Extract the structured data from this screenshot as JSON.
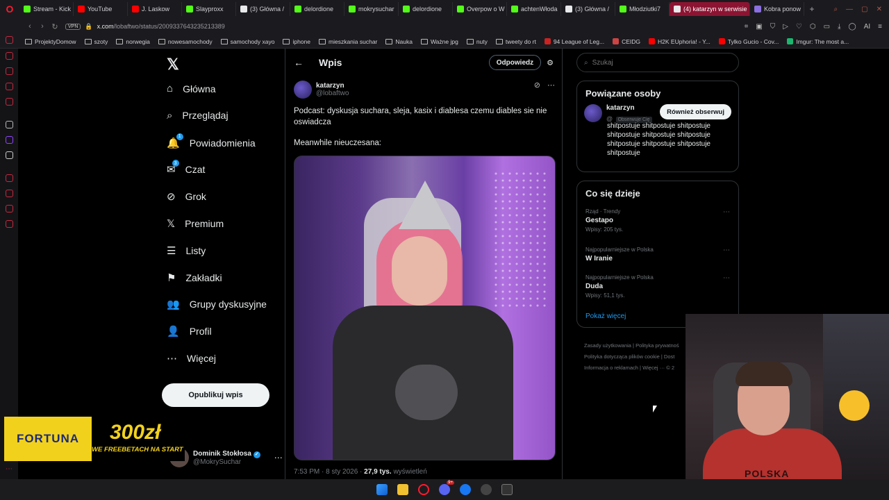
{
  "browser": {
    "tabs": [
      {
        "label": "Stream - Kick",
        "color": "#53fc18",
        "active": false
      },
      {
        "label": "YouTube",
        "color": "#ff0000",
        "active": false
      },
      {
        "label": "J. Laskow",
        "color": "#ff0000",
        "active": false
      },
      {
        "label": "Slayproxx",
        "color": "#53fc18",
        "active": false
      },
      {
        "label": "(3) Główna /",
        "color": "#e7e9ea",
        "active": false
      },
      {
        "label": "delordione",
        "color": "#53fc18",
        "active": false
      },
      {
        "label": "mokrysuchar",
        "color": "#53fc18",
        "active": false
      },
      {
        "label": "delordione",
        "color": "#53fc18",
        "active": false
      },
      {
        "label": "Overpow o W",
        "color": "#53fc18",
        "active": false
      },
      {
        "label": "achtenWłoda",
        "color": "#53fc18",
        "active": false
      },
      {
        "label": "(3) Główna /",
        "color": "#e7e9ea",
        "active": false
      },
      {
        "label": "Młodziutki7",
        "color": "#53fc18",
        "active": false
      },
      {
        "label": "(4) katarzyn w serwisie",
        "color": "#e7e9ea",
        "active": true
      },
      {
        "label": "Kobra ponow",
        "color": "#8a6fe0",
        "active": false
      }
    ],
    "vpn_label": "VPN",
    "url_host": "x.com",
    "url_path": "/lobaftwo/status/2009337643235213389",
    "ai_label": "AI",
    "bookmarks": [
      {
        "label": "ProjektyDomow",
        "type": "folder"
      },
      {
        "label": "szoty",
        "type": "folder"
      },
      {
        "label": "norwegia",
        "type": "folder"
      },
      {
        "label": "nowesamochody",
        "type": "folder"
      },
      {
        "label": "samochody xayo",
        "type": "folder"
      },
      {
        "label": "iphone",
        "type": "folder"
      },
      {
        "label": "mieszkania suchar",
        "type": "folder"
      },
      {
        "label": "Nauka",
        "type": "folder"
      },
      {
        "label": "Ważne jpg",
        "type": "folder"
      },
      {
        "label": "nuty",
        "type": "folder"
      },
      {
        "label": "tweety do rt",
        "type": "folder"
      },
      {
        "label": "94 League of Leg...",
        "type": "site",
        "color": "#c22"
      },
      {
        "label": "CEIDG",
        "type": "site",
        "color": "#c44"
      },
      {
        "label": "H2K EUphoria! - Y...",
        "type": "site",
        "color": "#ff0000"
      },
      {
        "label": "Tylko Gucio - Cov...",
        "type": "site",
        "color": "#ff0000"
      },
      {
        "label": "Imgur: The most a...",
        "type": "site",
        "color": "#1bb76e"
      }
    ]
  },
  "nav": {
    "items": [
      {
        "label": "Główna",
        "icon": "⌂",
        "badge": ""
      },
      {
        "label": "Przeglądaj",
        "icon": "⌕",
        "badge": ""
      },
      {
        "label": "Powiadomienia",
        "icon": "🔔",
        "badge": "1"
      },
      {
        "label": "Czat",
        "icon": "✉",
        "badge": "3"
      },
      {
        "label": "Grok",
        "icon": "⊘",
        "badge": ""
      },
      {
        "label": "Premium",
        "icon": "𝕏",
        "badge": ""
      },
      {
        "label": "Listy",
        "icon": "☰",
        "badge": ""
      },
      {
        "label": "Zakładki",
        "icon": "⚑",
        "badge": ""
      },
      {
        "label": "Grupy dyskusyjne",
        "icon": "👥",
        "badge": ""
      },
      {
        "label": "Profil",
        "icon": "👤",
        "badge": ""
      },
      {
        "label": "Więcej",
        "icon": "⋯",
        "badge": ""
      }
    ],
    "post_button": "Opublikuj wpis",
    "me": {
      "name": "Dominik Stokłosa",
      "handle": "@MokrySuchar"
    }
  },
  "main": {
    "title": "Wpis",
    "reply_button": "Odpowiedz",
    "post": {
      "author_name": "katarzyn",
      "author_handle": "@lobaftwo",
      "text": "Podcast: dyskusja suchara, sleja, kasix i diablesa czemu diables sie nie oswiadcza",
      "text2": "Meanwhile nieuczesana:",
      "time": "7:53 PM · 8 sty 2026",
      "views_count": "27,9 tys.",
      "views_label": "wyświetleń"
    }
  },
  "right": {
    "search_placeholder": "Szukaj",
    "related": {
      "title": "Powiązane osoby",
      "name": "katarzyn",
      "handle_prefix": "@",
      "follows_you": "Obserwuje Cię",
      "follow_button": "Również obserwuj",
      "bio": "shitpostuje shitpostuje shitpostuje shitpostuje shitpostuje shitpostuje shitpostuje shitpostuje shitpostuje shitpostuje"
    },
    "trends": {
      "title": "Co się dzieje",
      "items": [
        {
          "category": "Rząd · Trendy",
          "name": "Gestapo",
          "count": "Wpisy: 205 tys."
        },
        {
          "category": "Najpopularniejsze w Polska",
          "name": "W Iranie",
          "count": ""
        },
        {
          "category": "Najpopularniejsze w Polska",
          "name": "Duda",
          "count": "Wpisy: 51,1 tys."
        }
      ],
      "show_more": "Pokaż więcej"
    },
    "footer": {
      "line1": "Zasady użytkowania  |  Polityka prywatnoś",
      "line2": "Polityka dotycząca plików cookie  |  Dost",
      "line3": "Informacja o reklamach  |  Więcej ···  © 2"
    }
  },
  "ad": {
    "brand": "FORTUNA",
    "amount": "300zł",
    "subtitle": "WE FREEBETACH NA START"
  },
  "webcam": {
    "shirt_text": "POLSKA"
  },
  "taskbar": {
    "badge": "9+"
  }
}
